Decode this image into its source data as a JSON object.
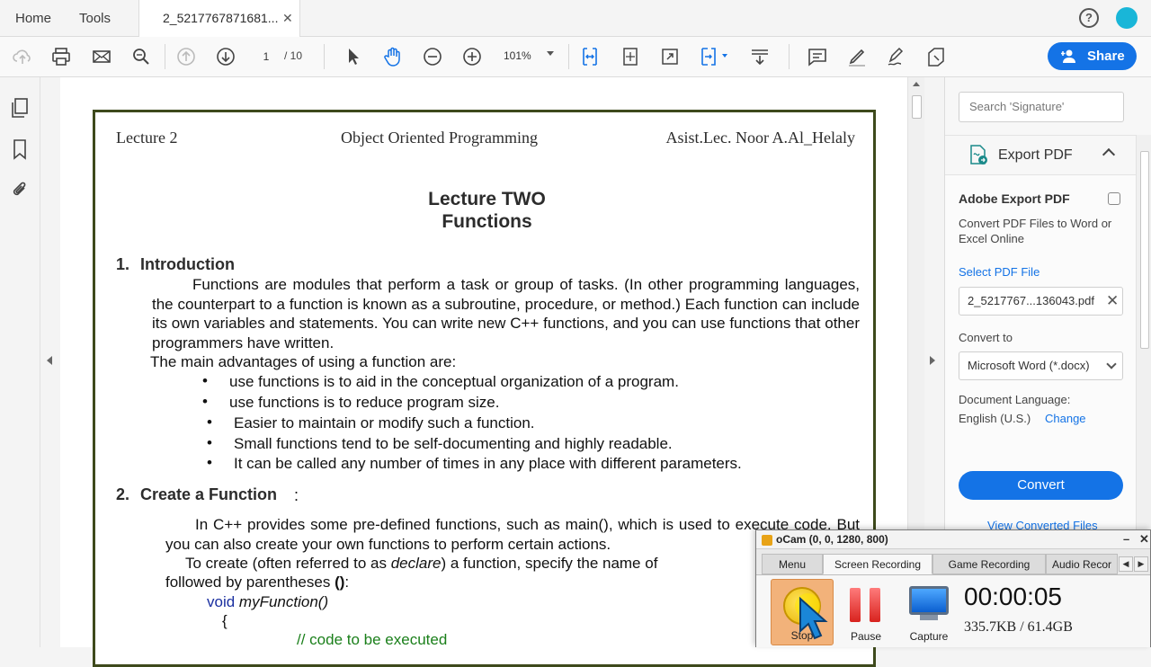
{
  "topbar": {
    "home_label": "Home",
    "tools_label": "Tools",
    "doc_tab_label": "2_5217767871681...",
    "close_glyph": "✕",
    "help_glyph": "?"
  },
  "toolbar": {
    "page_current": "1",
    "page_total": "/ 10",
    "zoom": "101%",
    "share_label": "Share"
  },
  "document": {
    "header_left": "Lecture 2",
    "header_center": "Object Oriented Programming",
    "header_right": "Asist.Lec. Noor A.Al_Helaly",
    "title_line1": "Lecture TWO",
    "title_line2": "Functions",
    "section1_num": "1.",
    "section1_title": "Introduction",
    "intro_paragraph": "Functions are modules that perform a task or group of tasks. (In other programming languages, the counterpart to a function is known as a subroutine, procedure, or method.) Each function can include its own variables and statements. You can write new C++ functions, and you can use functions that other programmers have written.",
    "advantages_intro": "The main advantages of using a function are:",
    "advantages": [
      "use functions is to aid in the conceptual organization of a program.",
      "use functions  is to reduce program size.",
      "Easier to maintain or modify such a function.",
      "Small functions tend to be self-documenting and highly readable.",
      "It can be called any number of times in any place with different parameters."
    ],
    "section2_num": "2.",
    "section2_title": "Create a Function",
    "section2_colon": ":",
    "create_paragraph": "In C++ provides some pre-defined functions, such as main(), which is used to execute code. But you can also create your own functions to perform certain actions.",
    "declare_pre": "To create (often referred to as",
    "declare_word": "declare",
    "declare_post": ") a function, specify the name of",
    "declare_line2_pre": "followed by parentheses",
    "declare_line2_paren": "()",
    "declare_line2_post": ":",
    "code_kw": "void",
    "code_fn": "myFunction()",
    "code_brace": "{",
    "code_comment": "// code to be executed"
  },
  "right_panel": {
    "search_placeholder": "Search 'Signature'",
    "export_title": "Export PDF",
    "aep_title": "Adobe Export PDF",
    "aep_desc": "Convert PDF Files to Word or Excel Online",
    "select_label": "Select PDF File",
    "file_name": "2_5217767...136043.pdf",
    "file_remove_glyph": "✕",
    "convert_to_label": "Convert to",
    "convert_to_value": "Microsoft Word (*.docx)",
    "lang_label": "Document Language:",
    "lang_value": "English (U.S.)",
    "lang_change": "Change",
    "convert_button": "Convert",
    "view_converted": "View Converted Files"
  },
  "ocam": {
    "title": "oCam (0, 0, 1280, 800)",
    "min_glyph": "–",
    "close_glyph": "✕",
    "tabs": [
      "Menu",
      "Screen Recording",
      "Game Recording",
      "Audio Recor"
    ],
    "tab_left": "◀",
    "tab_right": "▶",
    "stop_label": "Stop",
    "pause_label": "Pause",
    "capture_label": "Capture",
    "timer": "00:00:05",
    "size": "335.7KB / 61.4GB"
  },
  "colors": {
    "accent": "#1473e6",
    "page_border": "#3e4a1c",
    "code_keyword": "#1a2fa0",
    "code_comment": "#1a7f1a"
  }
}
